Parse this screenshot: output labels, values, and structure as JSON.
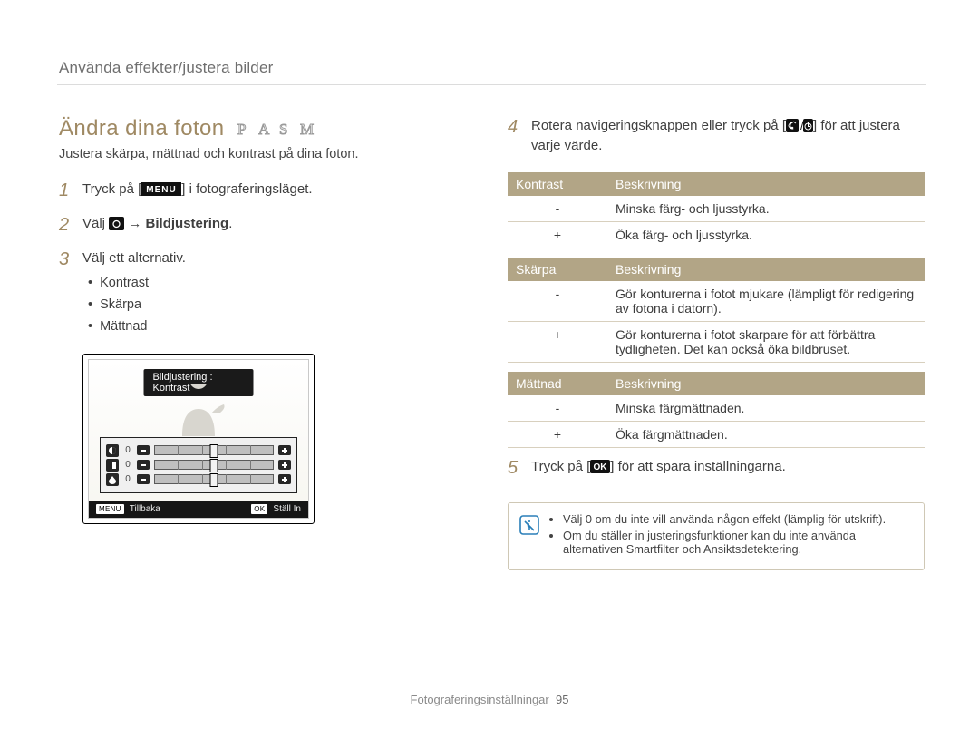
{
  "breadcrumb": "Använda effekter/justera bilder",
  "title": "Ändra dina foton",
  "mode_icons": [
    "P",
    "A",
    "S",
    "M"
  ],
  "subtitle": "Justera skärpa, mättnad och kontrast på dina foton.",
  "steps_left": [
    {
      "n": "1",
      "pre": "Tryck på [",
      "icon": "menu",
      "post": "] i fotograferingsläget."
    },
    {
      "n": "2",
      "pre": "Välj ",
      "icon": "camera",
      "post": " → ",
      "bold": "Bildjustering",
      "tail": "."
    },
    {
      "n": "3",
      "text": "Välj ett alternativ.",
      "bullets": [
        "Kontrast",
        "Skärpa",
        "Mättnad"
      ]
    }
  ],
  "lcd": {
    "banner": "Bildjustering : Kontrast",
    "rows": [
      {
        "icon": "contrast",
        "value": "0"
      },
      {
        "icon": "sharpness",
        "value": "0"
      },
      {
        "icon": "saturation",
        "value": "0"
      }
    ],
    "back_key": "MENU",
    "back_label": "Tillbaka",
    "set_key": "OK",
    "set_label": "Ställ In"
  },
  "steps_right": [
    {
      "n": "4",
      "pre": "Rotera navigeringsknappen eller tryck på [",
      "icon": "macro-timer",
      "post": "] för att justera varje värde."
    },
    {
      "n": "5",
      "pre": "Tryck på [",
      "icon": "ok",
      "post": "] för att spara inställningarna."
    }
  ],
  "tables": [
    {
      "head": [
        "Kontrast",
        "Beskrivning"
      ],
      "rows": [
        {
          "sym": "-",
          "desc": "Minska färg- och ljusstyrka."
        },
        {
          "sym": "+",
          "desc": "Öka färg- och ljusstyrka."
        }
      ]
    },
    {
      "head": [
        "Skärpa",
        "Beskrivning"
      ],
      "rows": [
        {
          "sym": "-",
          "desc": "Gör konturerna i fotot mjukare (lämpligt för redigering av fotona i datorn)."
        },
        {
          "sym": "+",
          "desc": "Gör konturerna i fotot skarpare för att förbättra tydligheten. Det kan också öka bildbruset."
        }
      ]
    },
    {
      "head": [
        "Mättnad",
        "Beskrivning"
      ],
      "rows": [
        {
          "sym": "-",
          "desc": "Minska färgmättnaden."
        },
        {
          "sym": "+",
          "desc": "Öka färgmättnaden."
        }
      ]
    }
  ],
  "notes": [
    "Välj 0 om du inte vill använda någon effekt (lämplig för utskrift).",
    "Om du ställer in justeringsfunktioner kan du inte använda alternativen Smartfilter och Ansiktsdetektering."
  ],
  "footer_section": "Fotograferingsinställningar",
  "footer_page": "95"
}
